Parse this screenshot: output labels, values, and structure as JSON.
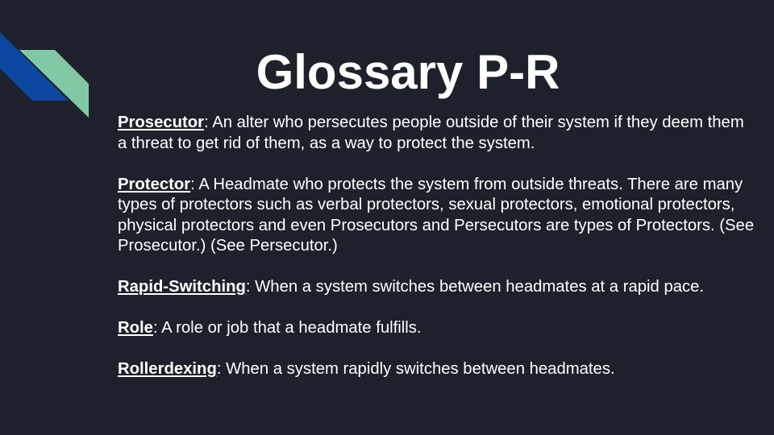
{
  "slide": {
    "title": "Glossary P-R",
    "entries": [
      {
        "term": "Prosecutor",
        "separator": ":",
        "definition": " An alter who persecutes people outside of their system if they deem them a threat to get rid of them, as a way to protect the system."
      },
      {
        "term": "Protector",
        "separator": ":",
        "definition": " A Headmate who protects the system from outside threats. There are many types of protectors such as verbal protectors, sexual protectors, emotional protectors, physical protectors and even Prosecutors and Persecutors are types of Protectors. (See Prosecutor.) (See Persecutor.)"
      },
      {
        "term": "Rapid-Switching",
        "separator": ":",
        "definition": " When a system switches between headmates at a rapid pace."
      },
      {
        "term": "Role",
        "separator": ":",
        "definition": " A role or job that a headmate fulfills."
      },
      {
        "term": "Rollerdexing",
        "separator": ":",
        "definition": " When a system rapidly switches between headmates."
      }
    ]
  },
  "colors": {
    "background": "#1d212b",
    "text": "#ffffff",
    "accent_blue": "#0d47a1",
    "accent_green": "#81c9a5"
  }
}
